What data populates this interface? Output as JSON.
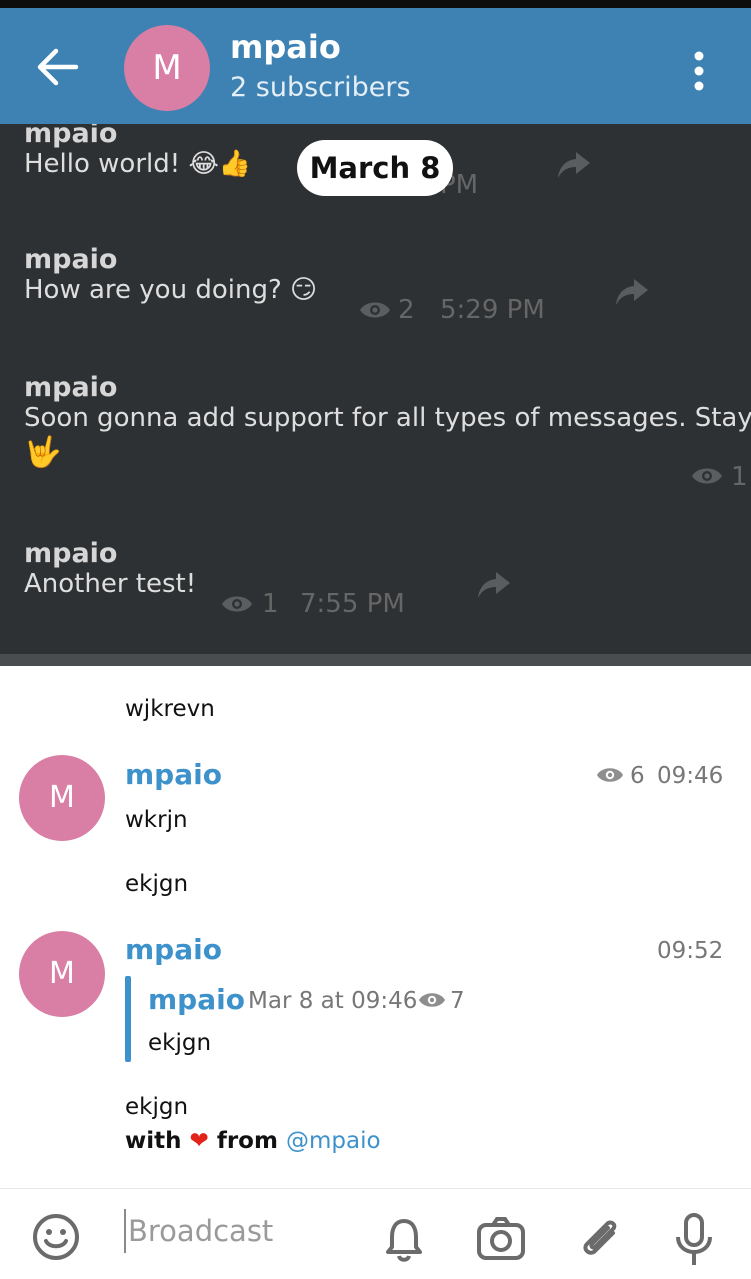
{
  "header": {
    "avatar_letter": "M",
    "title": "mpaio",
    "subtitle": "2 subscribers"
  },
  "dark_panel": {
    "date_pill": "March 8",
    "messages": [
      {
        "sender": "mpaio",
        "text": "Hello world! 😂👍",
        "time": "PM"
      },
      {
        "sender": "mpaio",
        "text": "How are you doing? 😏",
        "views": "2",
        "time": "5:29 PM"
      },
      {
        "sender": "mpaio",
        "text": "Soon gonna add support for all types of messages. Stay",
        "emoji": "🤟",
        "views": "1"
      },
      {
        "sender": "mpaio",
        "text": "Another test!",
        "views": "1",
        "time": "7:55 PM"
      }
    ]
  },
  "feed": {
    "top_text": "wjkrevn",
    "post1": {
      "avatar_letter": "M",
      "sender": "mpaio",
      "views": "6",
      "time": "09:46",
      "text": "wkrjn",
      "after_text": "ekjgn"
    },
    "post2": {
      "avatar_letter": "M",
      "sender": "mpaio",
      "time": "09:52",
      "reply": {
        "sender": "mpaio",
        "date": "Mar 8 at 09:46",
        "views": "7",
        "text": "ekjgn"
      },
      "text": "ekjgn",
      "footer": {
        "prefix": "with",
        "heart": "❤",
        "middle": "from",
        "link": "@mpaio"
      }
    }
  },
  "composer": {
    "placeholder": "Broadcast",
    "icons": [
      "smiley-icon",
      "bell-icon",
      "camera-icon",
      "paperclip-icon",
      "microphone-icon"
    ]
  },
  "colors": {
    "header": "#3d82b3",
    "avatar": "#d97ea4",
    "accent": "#3e92cc",
    "dark_bg": "#2e3133"
  }
}
